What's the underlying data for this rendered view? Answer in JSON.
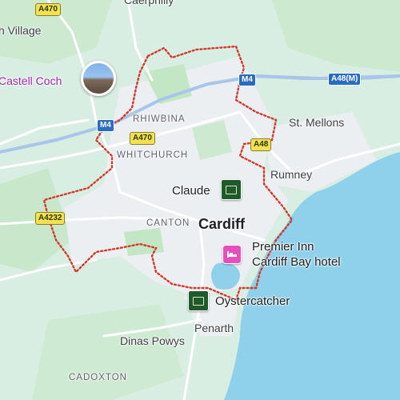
{
  "places": {
    "caerphilly": "Caerphilly",
    "village": "h Village",
    "castell_coch": "Castell Coch",
    "rhiwbina": "RHIWBINA",
    "whitchurch": "WHITCHURCH",
    "st_mellons": "St. Mellons",
    "rumney": "Rumney",
    "claude": "Claude",
    "canton": "CANTON",
    "cardiff": "Cardiff",
    "premier_inn": "Premier Inn\nCardiff Bay hotel",
    "oystercatcher": "Oystercatcher",
    "penarth": "Penarth",
    "dinas_powys": "Dinas Powys",
    "cadoxton": "CADOXTON"
  },
  "roads": {
    "a470_top": "A470",
    "a470_mid": "A470",
    "m4_left": "M4",
    "m4_right": "M4",
    "a48m": "A48(M)",
    "a48": "A48",
    "a4232": "A4232"
  },
  "colors": {
    "land": "#d9eee2",
    "park": "#c3e6c5",
    "urban": "#eef0f3",
    "water": "#8fd0ea",
    "road": "#ffffff",
    "motorway": "#a9c5ea",
    "boundary": "#d23a2e"
  }
}
